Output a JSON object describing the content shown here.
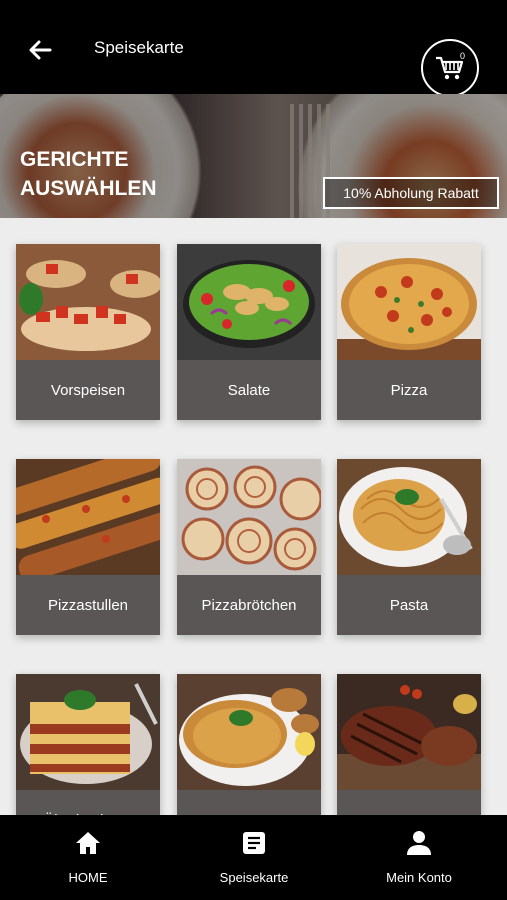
{
  "header": {
    "title": "Speisekarte",
    "cart_count": "0"
  },
  "hero": {
    "heading_line1": "GERICHTE",
    "heading_line2": "AUSWÄHLEN",
    "badge": "10% Abholung Rabatt"
  },
  "categories": [
    {
      "label": "Vorspeisen"
    },
    {
      "label": "Salate"
    },
    {
      "label": "Pizza"
    },
    {
      "label": "Pizzastullen"
    },
    {
      "label": "Pizzabrötchen"
    },
    {
      "label": "Pasta"
    },
    {
      "label": "Überbackene"
    },
    {
      "label": ""
    },
    {
      "label": ""
    }
  ],
  "bottom_nav": [
    {
      "label": "HOME",
      "icon": "home-icon"
    },
    {
      "label": "Speisekarte",
      "icon": "menu-list-icon"
    },
    {
      "label": "Mein Konto",
      "icon": "person-icon"
    }
  ],
  "colors": {
    "bar": "#000000",
    "card_label_bg": "#5a5655",
    "page_bg": "#ededed"
  }
}
